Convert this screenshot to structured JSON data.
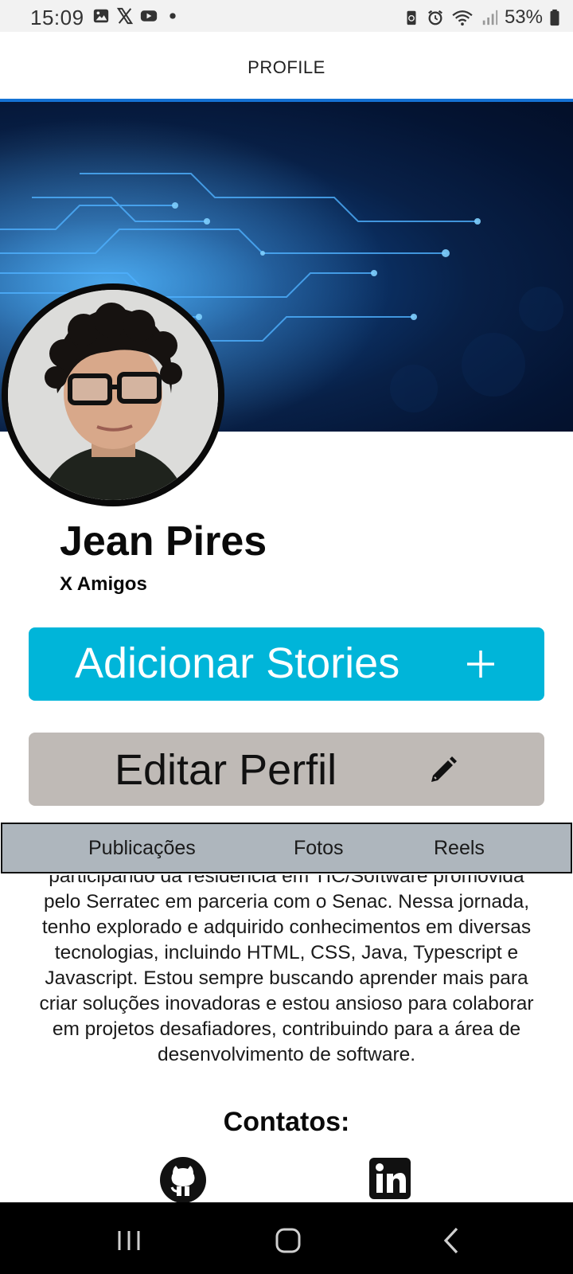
{
  "status_bar": {
    "time": "15:09",
    "battery": "53%",
    "left_icons": [
      "gallery-icon",
      "x-icon",
      "youtube-icon",
      "dot-icon"
    ],
    "right_icons": [
      "battery-saver-icon",
      "alarm-icon",
      "wifi-icon",
      "signal-icon",
      "battery-icon"
    ]
  },
  "header": {
    "title": "PROFILE",
    "accent_color": "#1572d4"
  },
  "profile": {
    "name": "Jean Pires",
    "friends": "X Amigos"
  },
  "buttons": {
    "add_stories": "Adicionar Stories",
    "edit_profile": "Editar Perfil",
    "add_stories_color": "#00b5d9",
    "edit_profile_color": "#bfbab6"
  },
  "tabs": [
    "Publicações",
    "Fotos",
    "Reels"
  ],
  "bio": {
    "lines": [
      "participando da residência em TIC/Software promovida",
      "pelo Serratec em parceria com o Senac. Nessa jornada,",
      "tenho explorado e adquirido conhecimentos em diversas",
      "tecnologias, incluindo HTML, CSS, Java, Typescript e",
      "Javascript. Estou sempre buscando aprender mais para",
      "criar soluções inovadoras e estou ansioso para colaborar",
      "em projetos desafiadores, contribuindo para a área de",
      "desenvolvimento de software."
    ]
  },
  "contacts": {
    "title": "Contatos:",
    "items": [
      "github-icon",
      "linkedin-icon"
    ]
  },
  "nav": [
    "recent-apps-icon",
    "home-icon",
    "back-icon"
  ]
}
